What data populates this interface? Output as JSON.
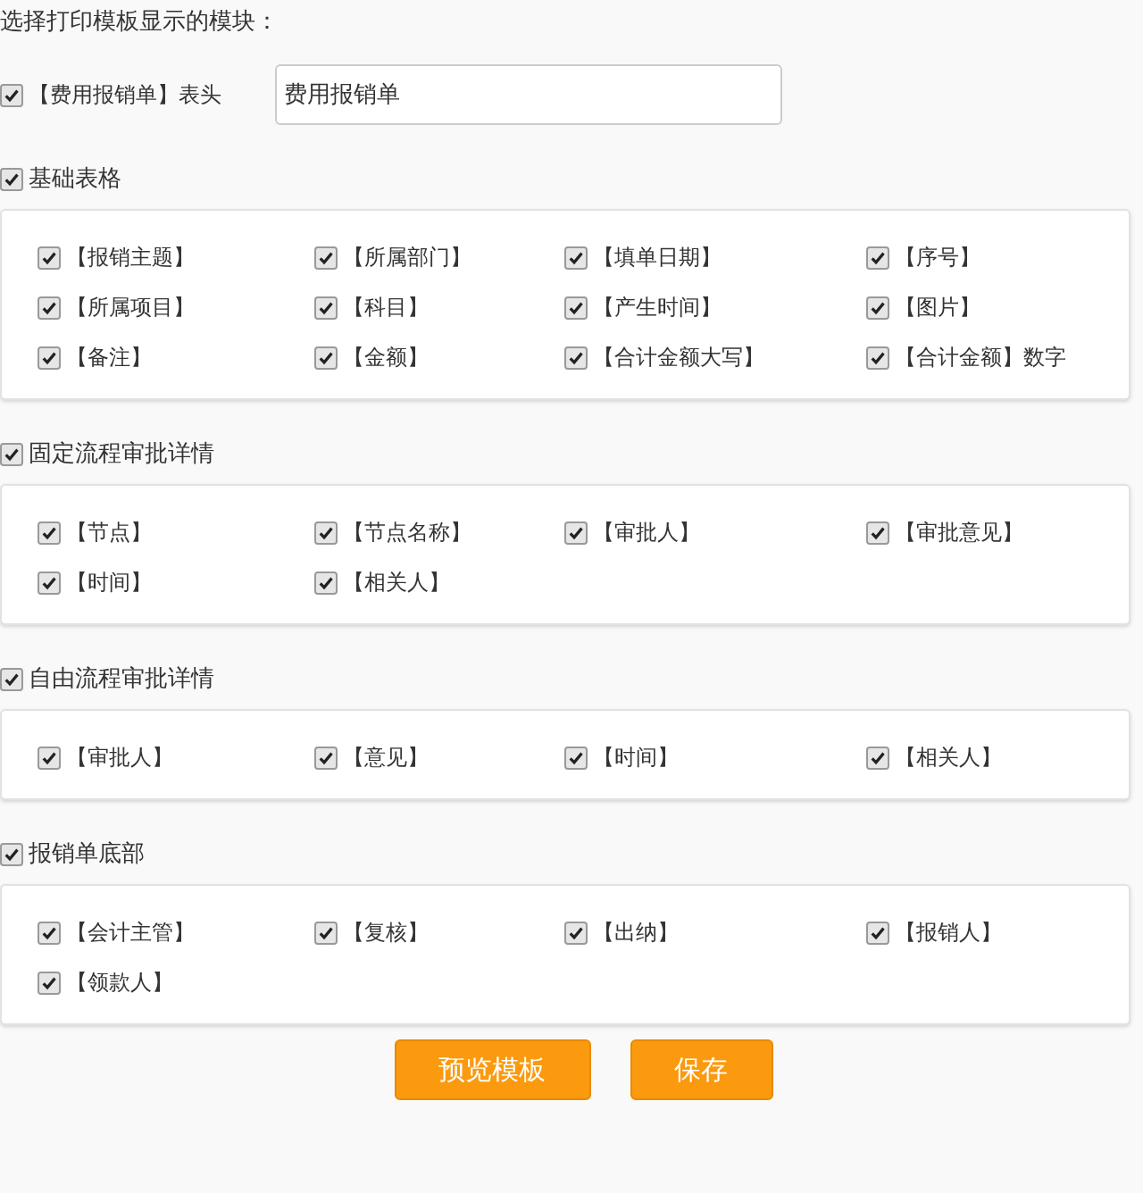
{
  "prompt": "选择打印模板显示的模块：",
  "header": {
    "checked": true,
    "label": "【费用报销单】表头",
    "value": "费用报销单"
  },
  "sections": [
    {
      "title": "基础表格",
      "checked": true,
      "items": [
        {
          "label": "【报销主题】",
          "checked": true
        },
        {
          "label": "【所属部门】",
          "checked": true
        },
        {
          "label": "【填单日期】",
          "checked": true
        },
        {
          "label": "【序号】",
          "checked": true
        },
        {
          "label": "【所属项目】",
          "checked": true
        },
        {
          "label": "【科目】",
          "checked": true
        },
        {
          "label": "【产生时间】",
          "checked": true
        },
        {
          "label": "【图片】",
          "checked": true
        },
        {
          "label": "【备注】",
          "checked": true
        },
        {
          "label": "【金额】",
          "checked": true
        },
        {
          "label": "【合计金额大写】",
          "checked": true
        },
        {
          "label": "【合计金额】数字",
          "checked": true
        }
      ]
    },
    {
      "title": "固定流程审批详情",
      "checked": true,
      "items": [
        {
          "label": "【节点】",
          "checked": true
        },
        {
          "label": "【节点名称】",
          "checked": true
        },
        {
          "label": "【审批人】",
          "checked": true
        },
        {
          "label": "【审批意见】",
          "checked": true
        },
        {
          "label": "【时间】",
          "checked": true
        },
        {
          "label": "【相关人】",
          "checked": true
        }
      ]
    },
    {
      "title": "自由流程审批详情",
      "checked": true,
      "items": [
        {
          "label": "【审批人】",
          "checked": true
        },
        {
          "label": "【意见】",
          "checked": true
        },
        {
          "label": "【时间】",
          "checked": true
        },
        {
          "label": "【相关人】",
          "checked": true
        }
      ]
    },
    {
      "title": "报销单底部",
      "checked": true,
      "items": [
        {
          "label": "【会计主管】",
          "checked": true
        },
        {
          "label": "【复核】",
          "checked": true
        },
        {
          "label": "【出纳】",
          "checked": true
        },
        {
          "label": "【报销人】",
          "checked": true
        },
        {
          "label": "【领款人】",
          "checked": true
        }
      ]
    }
  ],
  "buttons": [
    "预览模板",
    "保存"
  ]
}
